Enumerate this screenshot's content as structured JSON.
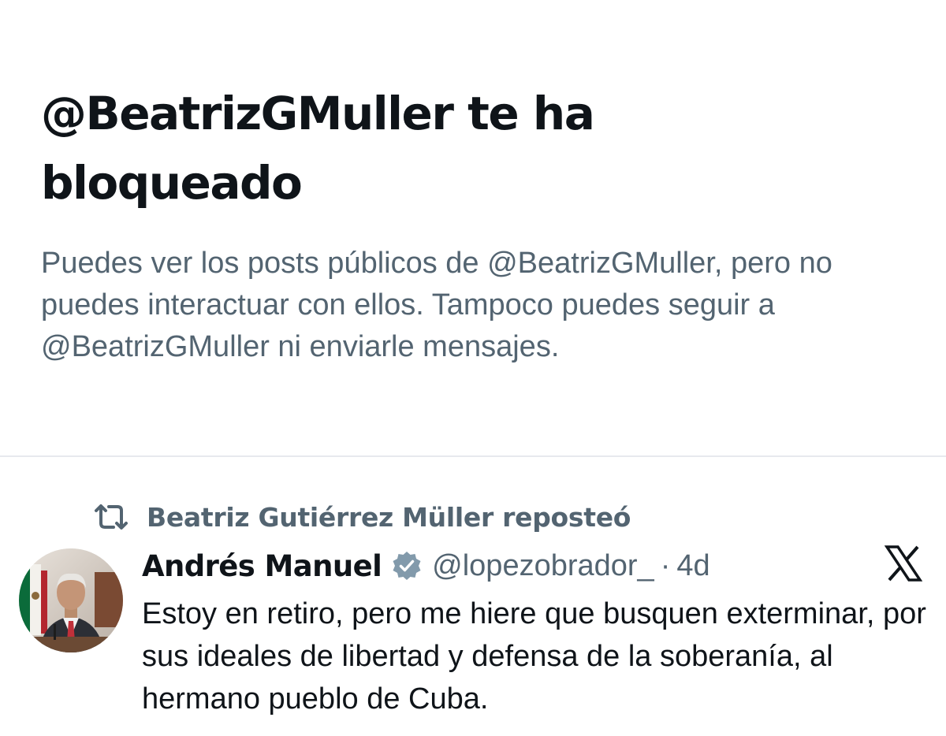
{
  "blocked_notice": {
    "title": "@BeatrizGMuller te ha bloqueado",
    "description": "Puedes ver los posts públicos de @BeatrizGMuller, pero no puedes interactuar con ellos. Tampoco puedes seguir a @BeatrizGMuller ni enviarle mensajes."
  },
  "repost": {
    "icon": "repost-icon",
    "text": "Beatriz Gutiérrez Müller reposteó"
  },
  "tweet": {
    "author_name": "Andrés Manuel",
    "verified_icon": "verified-badge-icon",
    "handle": "@lopezobrador_",
    "separator": "·",
    "time": "4d",
    "text": "Estoy en retiro, pero me hiere que busquen exterminar, por sus ideales de libertad y defensa de la soberanía, al hermano pueblo de Cuba.",
    "platform_icon": "x-logo-icon"
  },
  "colors": {
    "primary_text": "#0f1419",
    "secondary_text": "#536471",
    "divider": "#e7e9ee",
    "verified_badge": "#829aab"
  }
}
